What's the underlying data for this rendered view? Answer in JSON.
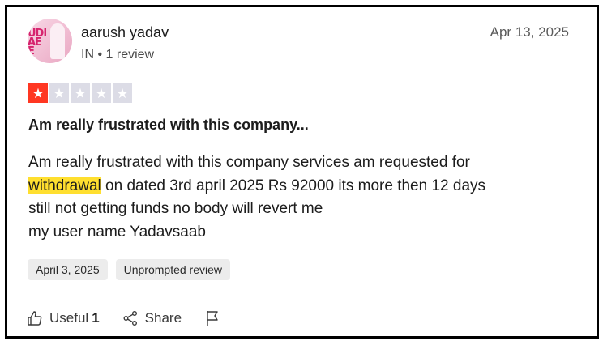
{
  "review": {
    "author": "aarush yadav",
    "country": "IN",
    "separator": "•",
    "review_count": "1 review",
    "date": "Apr 13, 2025",
    "rating": 1,
    "rating_max": 5,
    "title": "Am really frustrated with this company...",
    "body_line1": "Am really frustrated with this company services am requested for",
    "body_highlight": "withdrawal",
    "body_line2_rest": " on dated 3rd april 2025 Rs 92000 its more then 12 days",
    "body_line3": "still not getting funds no body will revert me",
    "body_line4": "my user name Yadavsaab",
    "avatar_text": "UDI\nAE\nE",
    "tags": [
      "April 3, 2025",
      "Unprompted review"
    ],
    "actions": {
      "useful_label": "Useful",
      "useful_count": "1",
      "share_label": "Share"
    },
    "colors": {
      "star_on": "#ff3722",
      "star_off": "#dcdce6",
      "highlight": "#ffdf2f"
    }
  }
}
